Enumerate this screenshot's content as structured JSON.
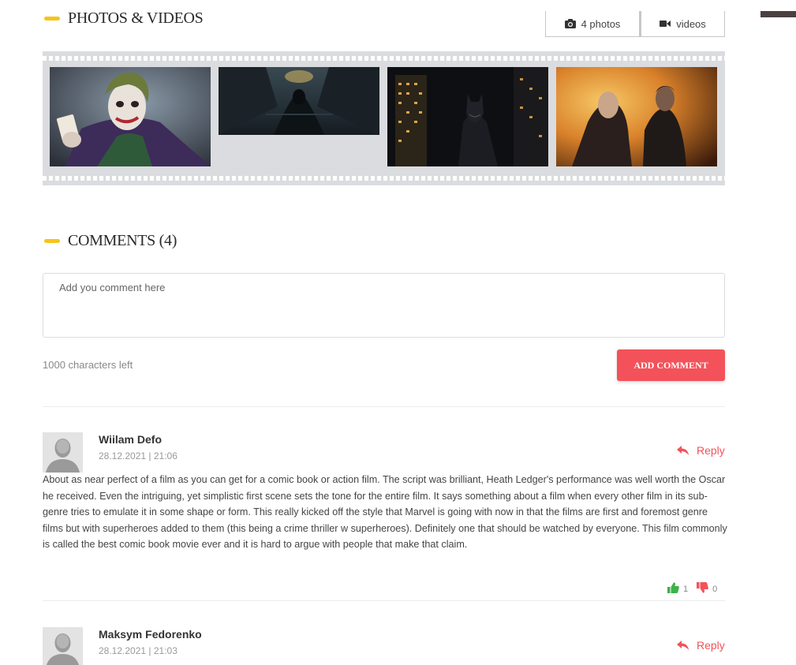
{
  "media": {
    "title": "PHOTOS & VIDEOS",
    "tabs": [
      {
        "label": "4 photos",
        "icon": "camera-icon"
      },
      {
        "label": "videos",
        "icon": "video-camera-icon"
      }
    ]
  },
  "comments": {
    "title": "COMMENTS (4)",
    "input_placeholder": "Add you comment here",
    "chars_left": "1000 characters left",
    "add_button": "ADD COMMENT",
    "reply_label": "Reply",
    "items": [
      {
        "author": "Wiilam Defo",
        "date": "28.12.2021 | 21:06",
        "text": "About as near perfect of a film as you can get for a comic book or action film. The script was brilliant, Heath Ledger's performance was well worth the Oscar he received. Even the intriguing, yet simplistic first scene sets the tone for the entire film. It says something about a film when every other film in its sub-genre tries to emulate it in some shape or form. This really kicked off the style that Marvel is going with now in that the films are first and foremost genre films but with superheroes added to them (this being a crime thriller w superheroes). Definitely one that should be watched by everyone. This film commonly is called the best comic book movie ever and it is hard to argue with people that make that claim.",
        "likes": "1",
        "dislikes": "0"
      },
      {
        "author": "Maksym Fedorenko",
        "date": "28.12.2021 | 21:03"
      }
    ]
  },
  "colors": {
    "accent_yellow": "#f5c518",
    "accent_red": "#f3525a",
    "like_green": "#3cb24a",
    "filmstrip_bg": "#dadcdf"
  }
}
